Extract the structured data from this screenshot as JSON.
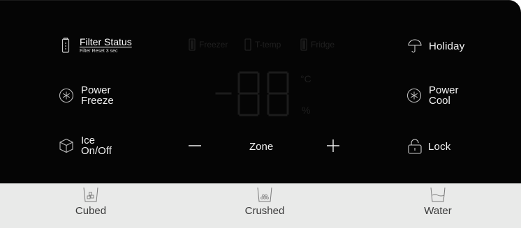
{
  "filter": {
    "title": "Filter Status",
    "subtitle": "Filter Reset 3 sec",
    "icon": "filter-icon"
  },
  "left_buttons": {
    "power_freeze": {
      "line1": "Power",
      "line2": "Freeze",
      "icon": "snowflake-icon"
    },
    "ice": {
      "line1": "Ice",
      "line2": "On/Off",
      "icon": "ice-cube-icon"
    }
  },
  "right_buttons": {
    "holiday": {
      "label": "Holiday",
      "icon": "umbrella-icon"
    },
    "power_cool": {
      "line1": "Power",
      "line2": "Cool",
      "icon": "snowflake-icon"
    },
    "lock": {
      "label": "Lock",
      "icon": "padlock-icon"
    }
  },
  "indicators": {
    "freezer": "Freezer",
    "ttemp": "T-temp",
    "fridge": "Fridge"
  },
  "display": {
    "unit_c": "°C",
    "unit_percent": "%"
  },
  "zone": {
    "label": "Zone",
    "minus_icon": "minus-icon",
    "plus_icon": "plus-icon"
  },
  "dispenser": {
    "cubed": {
      "label": "Cubed",
      "icon": "cubed-ice-cup-icon"
    },
    "crushed": {
      "label": "Crushed",
      "icon": "crushed-ice-cup-icon"
    },
    "water": {
      "label": "Water",
      "icon": "water-cup-icon"
    }
  },
  "colors": {
    "panel": "#050505",
    "text": "#f2f2f2",
    "dim": "#1e1e1e",
    "bottom_bar": "#e9eae9",
    "bottom_text": "#3a3a3a"
  }
}
